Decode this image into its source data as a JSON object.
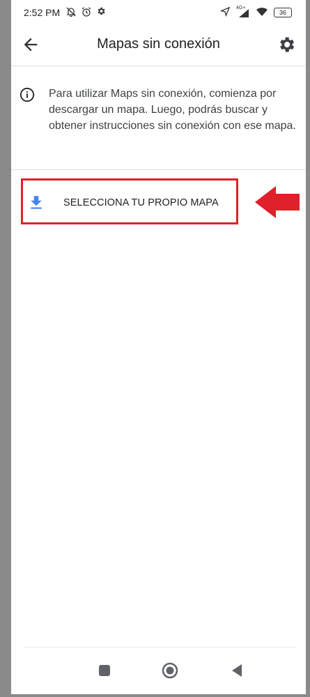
{
  "status_bar": {
    "time": "2:52 PM",
    "network": "4G+",
    "battery": "36",
    "icons": [
      "bell-off-icon",
      "alarm-icon",
      "gear-icon",
      "location-arrow-icon",
      "signal-icon",
      "wifi-icon",
      "battery-icon"
    ]
  },
  "app_bar": {
    "title": "Mapas sin conexión",
    "back_icon": "back-arrow-icon",
    "settings_icon": "gear-icon"
  },
  "info": {
    "icon": "info-icon",
    "text": "Para utilizar Maps sin conexión, comienza por descargar un mapa. Luego, podrás buscar y obtener instrucciones sin conexión con ese mapa."
  },
  "download": {
    "icon": "download-icon",
    "label": "SELECCIONA TU PROPIO MAPA"
  },
  "colors": {
    "accent_blue": "#4285f4",
    "highlight_red": "#e0202b"
  },
  "nav_bar": {
    "icons": [
      "recents-square-icon",
      "home-circle-icon",
      "back-triangle-icon"
    ]
  }
}
